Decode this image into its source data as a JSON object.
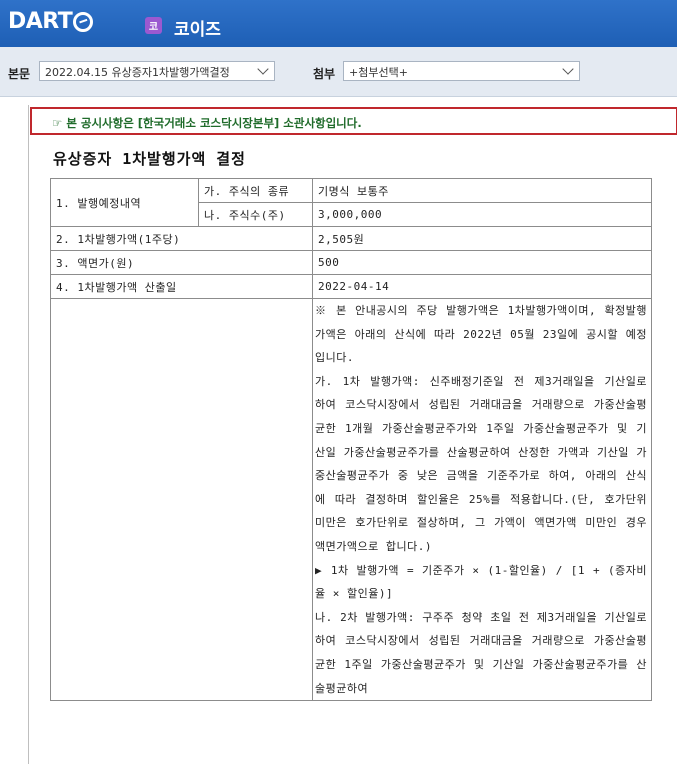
{
  "header": {
    "logo_text": "DART",
    "company_badge": "코",
    "company_name": "코이즈"
  },
  "toolbar": {
    "main_label": "본문",
    "main_select": "2022.04.15  유상증자1차발행가액결정",
    "attach_label": "첨부",
    "attach_select": "+첨부선택+"
  },
  "notice": "☞ 본 공시사항은 [한국거래소 코스닥시장본부] 소관사항입니다.",
  "document": {
    "title": "유상증자 1차발행가액 결정",
    "rows": {
      "r1_label": "1. 발행예정내역",
      "r1a_sub": "가. 주식의 종류",
      "r1a_val": "기명식 보통주",
      "r1b_sub": "나. 주식수(주)",
      "r1b_val": "3,000,000",
      "r2_label": "2. 1차발행가액(1주당)",
      "r2_val": "2,505원",
      "r3_label": "3. 액면가(원)",
      "r3_val": "500",
      "r4_label": "4. 1차발행가액 산출일",
      "r4_val": "2022-04-14"
    },
    "note_paragraphs": [
      "※ 본 안내공시의 주당 발행가액은 1차발행가액이며, 확정발행가액은 아래의 산식에 따라 2022년 05월 23일에 공시할 예정입니다.",
      "",
      "가. 1차 발행가액: 신주배정기준일 전 제3거래일을 기산일로 하여 코스닥시장에서 성립된 거래대금을 거래량으로 가중산술평균한 1개월 가중산술평균주가와 1주일 가중산술평균주가 및 기산일 가중산술평균주가를 산술평균하여 산정한 가액과 기산일 가중산술평균주가 중 낮은 금액을 기준주가로 하여, 아래의 산식에 따라 결정하며 할인율은 25%를 적용합니다.(단, 호가단위 미만은 호가단위로 절상하며, 그 가액이 액면가액 미만인 경우 액면가액으로 합니다.)",
      "",
      "▶ 1차 발행가액 = 기준주가 × (1-할인율) / [1 + (증자비율 × 할인율)]",
      "나. 2차 발행가액: 구주주 청약 초일 전 제3거래일을 기산일로 하여 코스닥시장에서 성립된 거래대금을 거래량으로 가중산술평균한 1주일 가중산술평균주가 및 기산일 가중산술평균주가를 산술평균하여"
    ]
  }
}
